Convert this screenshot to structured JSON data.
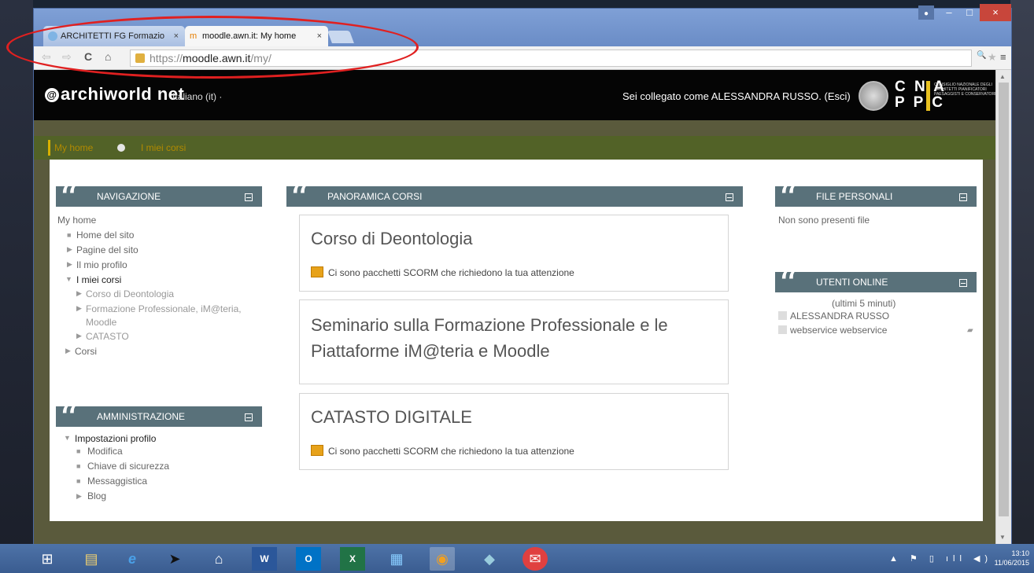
{
  "browser": {
    "tabs": [
      {
        "title": "ARCHITETTI FG Formazio"
      },
      {
        "title": "moodle.awn.it: My home"
      }
    ],
    "tab_close": "×",
    "url_scheme": "https://",
    "url_host": "moodle.awn.it",
    "url_path": "/my/",
    "back": "⇦",
    "forward": "⇨",
    "reload": "C",
    "home": "⌂",
    "zoom": "🔍",
    "star": "★",
    "menu": "≡",
    "window_min": "–",
    "window_max": "□",
    "window_close": "×"
  },
  "header": {
    "logo_at": "@",
    "logo_text": "archiworld net",
    "language": "Italiano (it) ·",
    "logged_in": "Sei collegato come ALESSANDRA RUSSO. (Esci)",
    "cna": "C N A",
    "ppc": "P P C",
    "cna_text": "CONSIGLIO NAZIONALE DEGLI ARCHITETTI PIANIFICATORI PAESAGGISTI E CONSERVATORI"
  },
  "breadcrumb": {
    "home": "My home",
    "courses": "I miei corsi"
  },
  "navigazione": {
    "title": "NAVIGAZIONE",
    "items": [
      "My home",
      "Home del sito",
      "Pagine del sito",
      "Il mio profilo",
      "I miei corsi",
      "Corso di Deontologia",
      "Formazione Professionale, iM@teria,",
      "Moodle",
      "CATASTO",
      "Corsi"
    ]
  },
  "amministrazione": {
    "title": "AMMINISTRAZIONE",
    "items": [
      "Impostazioni profilo",
      "Modifica",
      "Chiave di sicurezza",
      "Messaggistica",
      "Blog"
    ]
  },
  "panoramica": {
    "title": "PANORAMICA CORSI",
    "courses": [
      {
        "name": "Corso di Deontologia",
        "note": "Ci sono pacchetti SCORM che richiedono la tua attenzione"
      },
      {
        "name_line1": "Seminario sulla Formazione Professionale e le",
        "name_line2": "Piattaforme iM@teria e Moodle"
      },
      {
        "name": "CATASTO DIGITALE",
        "note": "Ci sono pacchetti SCORM che richiedono la tua attenzione"
      }
    ]
  },
  "file_personali": {
    "title": "FILE PERSONALI",
    "empty": "Non sono presenti file"
  },
  "utenti_online": {
    "title": "UTENTI ONLINE",
    "subtitle": "(ultimi 5 minuti)",
    "users": [
      "ALESSANDRA RUSSO",
      "webservice webservice"
    ]
  },
  "taskbar": {
    "time": "13:10",
    "date": "11/06/2015",
    "tray": "▲ ⚑ ▯ ıll ◀)"
  },
  "colors": {
    "annotation": "#e02020",
    "header_bg": "#050505",
    "block_header": "#59717a",
    "breadcrumb_bar": "#526227"
  }
}
